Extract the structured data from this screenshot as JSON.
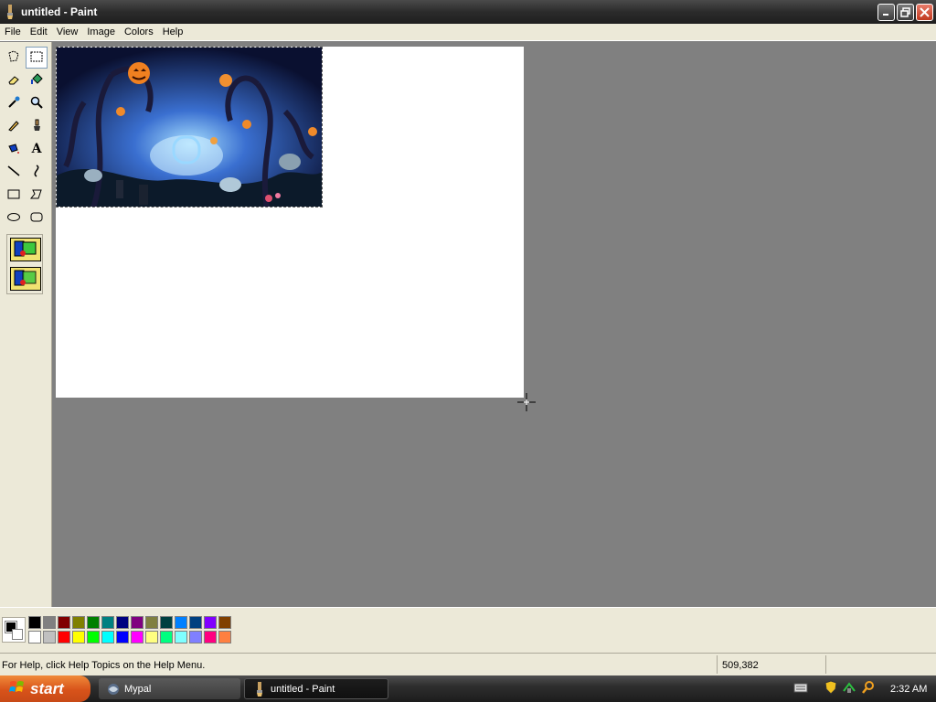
{
  "window": {
    "title": "untitled - Paint"
  },
  "menu": {
    "items": [
      "File",
      "Edit",
      "View",
      "Image",
      "Colors",
      "Help"
    ]
  },
  "toolbox": {
    "tools": [
      {
        "name": "free-form-select-icon"
      },
      {
        "name": "rectangle-select-icon",
        "selected": true
      },
      {
        "name": "eraser-icon"
      },
      {
        "name": "fill-bucket-icon"
      },
      {
        "name": "pick-color-icon"
      },
      {
        "name": "magnifier-icon"
      },
      {
        "name": "pencil-icon"
      },
      {
        "name": "brush-icon"
      },
      {
        "name": "airbrush-icon"
      },
      {
        "name": "text-icon"
      },
      {
        "name": "line-icon"
      },
      {
        "name": "curve-icon"
      },
      {
        "name": "rectangle-icon"
      },
      {
        "name": "polygon-icon"
      },
      {
        "name": "ellipse-icon"
      },
      {
        "name": "rounded-rectangle-icon"
      }
    ],
    "text_tool_glyph": "A"
  },
  "palette": {
    "foreground": "#000000",
    "background": "#ffffff",
    "colors_top": [
      "#000000",
      "#808080",
      "#800000",
      "#808000",
      "#008000",
      "#008080",
      "#000080",
      "#800080",
      "#808040",
      "#004040",
      "#0080ff",
      "#004080",
      "#8000ff",
      "#804000"
    ],
    "colors_bottom": [
      "#ffffff",
      "#c0c0c0",
      "#ff0000",
      "#ffff00",
      "#00ff00",
      "#00ffff",
      "#0000ff",
      "#ff00ff",
      "#ffff80",
      "#00ff80",
      "#80ffff",
      "#8080ff",
      "#ff0080",
      "#ff8040"
    ]
  },
  "status": {
    "help_text": "For Help, click Help Topics on the Help Menu.",
    "coordinates": "509,382",
    "size": ""
  },
  "taskbar": {
    "start_label": "start",
    "tasks": [
      {
        "label": "Mypal"
      },
      {
        "label": "untitled - Paint",
        "active": true
      }
    ],
    "clock": "2:32 AM"
  }
}
